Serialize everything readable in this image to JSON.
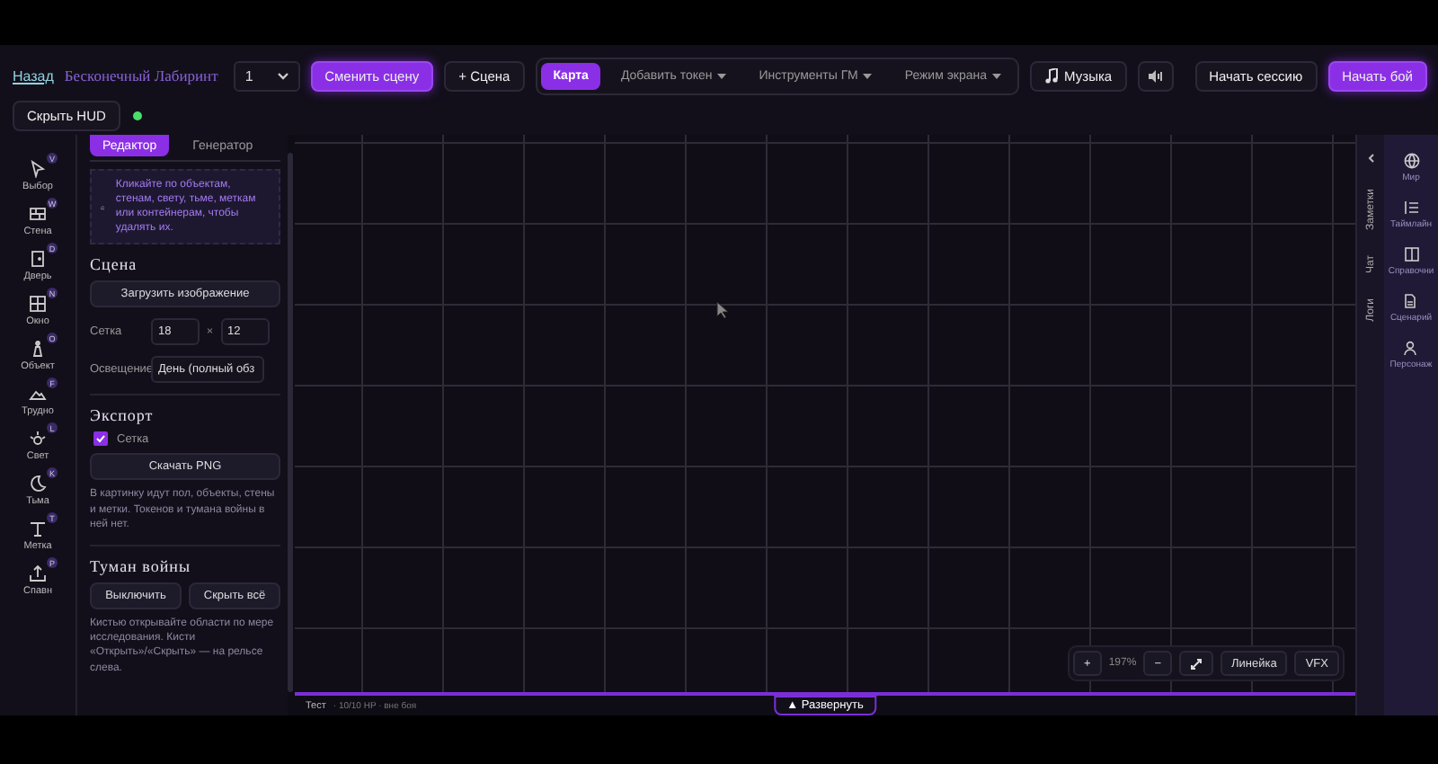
{
  "header": {
    "back": "Назад",
    "title": "Бесконечный Лабиринт",
    "scene_select": "1",
    "change_scene": "Сменить сцену",
    "add_scene": "+ Сцена",
    "mode_tabs": [
      {
        "label": "Карта",
        "selected": true,
        "dropdown": false
      },
      {
        "label": "Добавить токен",
        "selected": false,
        "dropdown": true
      },
      {
        "label": "Инструменты ГМ",
        "selected": false,
        "dropdown": true
      },
      {
        "label": "Режим экрана",
        "selected": false,
        "dropdown": true
      }
    ],
    "music": "Музыка",
    "start_session": "Начать сессию",
    "start_battle": "Начать бой",
    "hide_hud": "Скрыть HUD"
  },
  "tools": [
    {
      "label": "Выбор",
      "key": "V"
    },
    {
      "label": "Стена",
      "key": "W"
    },
    {
      "label": "Дверь",
      "key": "D"
    },
    {
      "label": "Окно",
      "key": "N"
    },
    {
      "label": "Объект",
      "key": "O"
    },
    {
      "label": "Трудно",
      "key": "F"
    },
    {
      "label": "Свет",
      "key": "L"
    },
    {
      "label": "Тьма",
      "key": "K"
    },
    {
      "label": "Метка",
      "key": "T"
    },
    {
      "label": "Спавн",
      "key": "P"
    }
  ],
  "panel": {
    "tabs": [
      {
        "label": "Редактор",
        "selected": true
      },
      {
        "label": "Генератор",
        "selected": false
      }
    ],
    "hint": "Кликайте по объектам, стенам, свету, тьме, меткам или контейнерам, чтобы удалять их.",
    "scene": {
      "heading": "Сцена",
      "upload": "Загрузить изображение",
      "grid_label": "Сетка",
      "grid_w": "18",
      "grid_x": "×",
      "grid_h": "12",
      "light_label": "Освещение",
      "light_value": "День (полный обз"
    },
    "export": {
      "heading": "Экспорт",
      "grid_checkbox": {
        "label": "Сетка",
        "checked": true
      },
      "download": "Скачать PNG",
      "note": "В картинку идут пол, объекты, стены и метки. Токенов и тумана войны в ней нет."
    },
    "fog": {
      "heading": "Туман войны",
      "buttons": [
        "Выключить",
        "Скрыть всё"
      ],
      "note": "Кистью открывайте области по мере исследования. Кисти «Открыть»/«Скрыть» — на рельсе слева."
    }
  },
  "map_controls": {
    "zoom_in": "+",
    "zoom": "197%",
    "zoom_out": "−",
    "ruler": "Линейка",
    "vfx": "VFX"
  },
  "status": {
    "name": "Тест",
    "info": "· 10/10 HP · вне боя",
    "expand": "▲ Развернуть"
  },
  "side_tabs": [
    "Заметки",
    "Чат",
    "Логи"
  ],
  "right_rail": [
    {
      "label": "Мир"
    },
    {
      "label": "Таймлайн"
    },
    {
      "label": "Справочни"
    },
    {
      "label": "Сценарий"
    },
    {
      "label": "Персонаж"
    }
  ]
}
